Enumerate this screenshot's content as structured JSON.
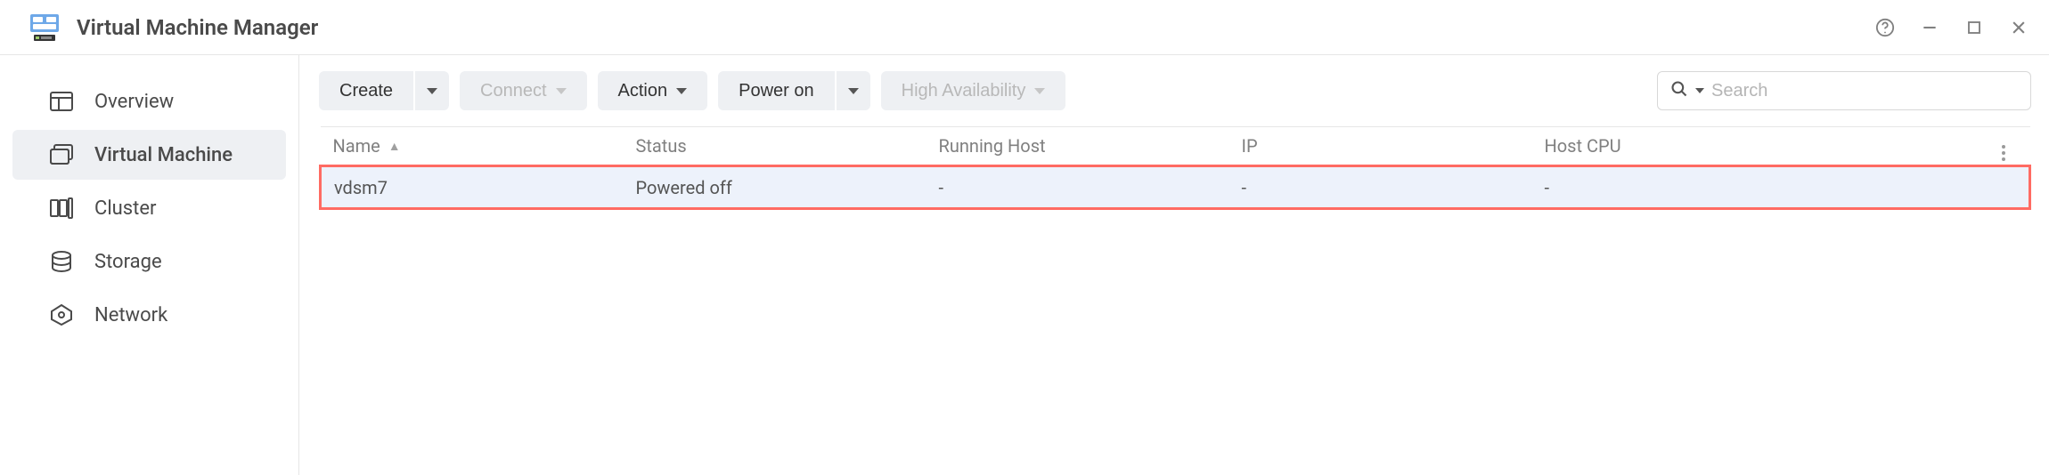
{
  "window": {
    "title": "Virtual Machine Manager"
  },
  "sidebar": {
    "items": [
      {
        "label": "Overview",
        "icon": "dashboard-icon",
        "active": false
      },
      {
        "label": "Virtual Machine",
        "icon": "vm-icon",
        "active": true
      },
      {
        "label": "Cluster",
        "icon": "cluster-icon",
        "active": false
      },
      {
        "label": "Storage",
        "icon": "storage-icon",
        "active": false
      },
      {
        "label": "Network",
        "icon": "network-icon",
        "active": false
      }
    ]
  },
  "toolbar": {
    "create": {
      "label": "Create",
      "disabled": false,
      "split": true
    },
    "connect": {
      "label": "Connect",
      "disabled": true,
      "split": false
    },
    "action": {
      "label": "Action",
      "disabled": false,
      "split": false
    },
    "poweron": {
      "label": "Power on",
      "disabled": false,
      "split": true
    },
    "ha": {
      "label": "High Availability",
      "disabled": true,
      "split": false
    },
    "search_placeholder": "Search"
  },
  "table": {
    "columns": {
      "name": {
        "label": "Name",
        "sorted": "asc"
      },
      "status": {
        "label": "Status"
      },
      "host": {
        "label": "Running Host"
      },
      "ip": {
        "label": "IP"
      },
      "cpu": {
        "label": "Host CPU"
      }
    },
    "rows": [
      {
        "name": "vdsm7",
        "status": "Powered off",
        "host": "-",
        "ip": "-",
        "cpu": "-",
        "selected": true,
        "highlighted": true
      }
    ]
  }
}
